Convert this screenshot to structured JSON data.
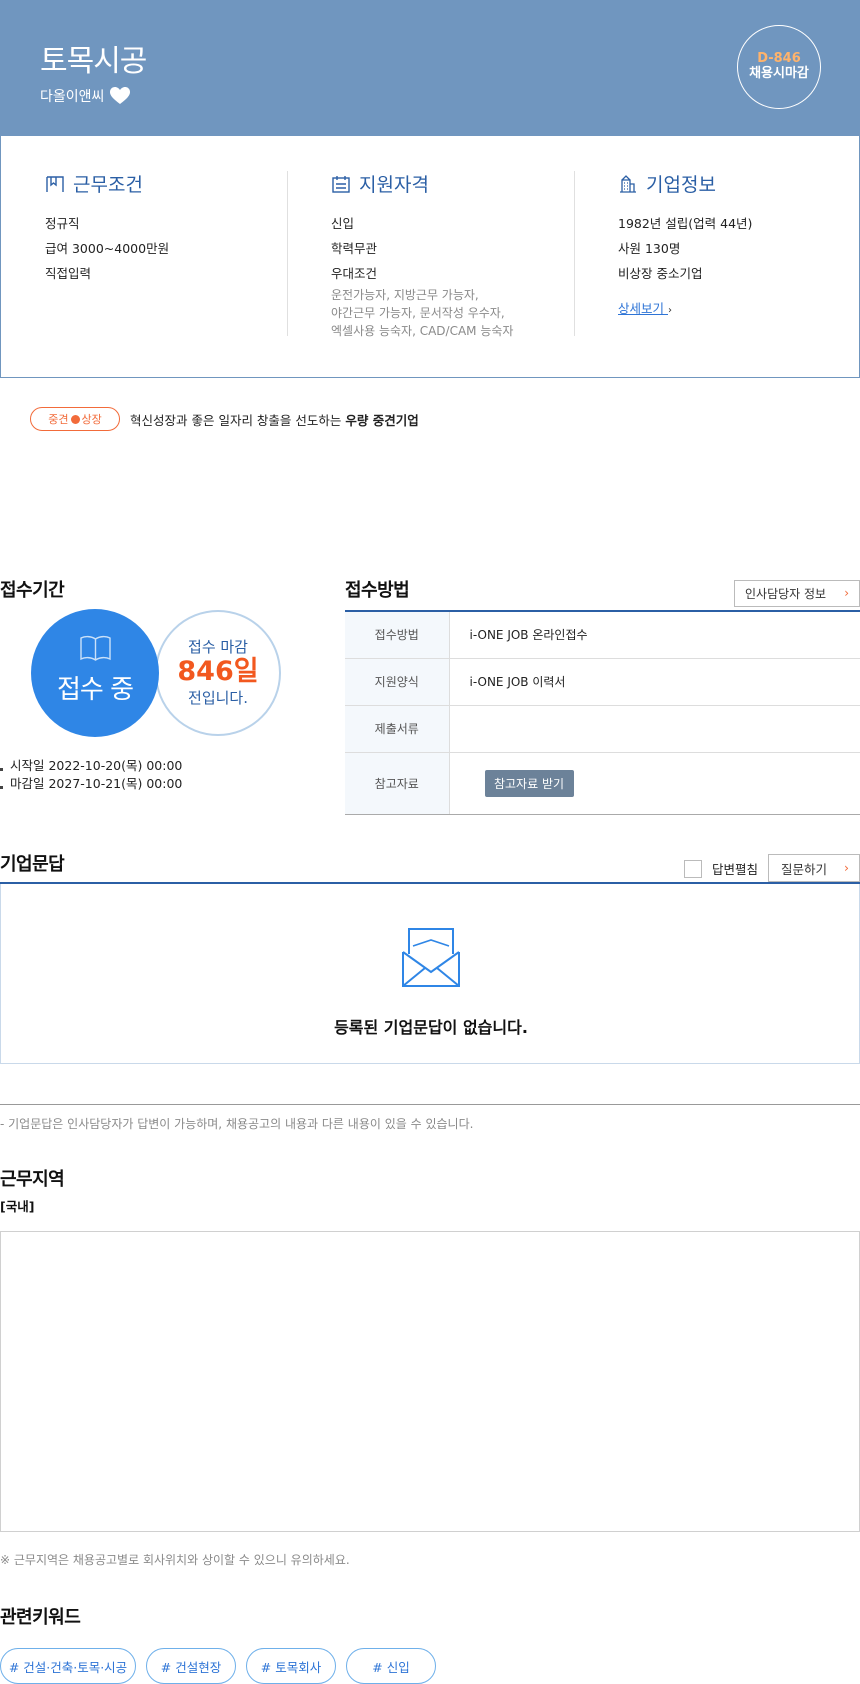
{
  "header": {
    "title": "토목시공",
    "company": "다올이앤씨",
    "dday": "D-846",
    "deadline_label": "채용시마감",
    "colors": {
      "hero_bg": "#7096bf",
      "accent": "#2b5fa5",
      "orange": "#f26b3a"
    }
  },
  "conditions": {
    "title": "근무조건",
    "icon": "bookmark-icon",
    "items": [
      "정규직",
      "급여 3000~4000만원",
      "직접입력"
    ]
  },
  "qualifications": {
    "title": "지원자격",
    "icon": "calendar-icon",
    "items": [
      "신입",
      "학력무관",
      "우대조건"
    ],
    "preferred": [
      "운전가능자, 지방근무 가능자,",
      "야간근무 가능자, 문서작성 우수자,",
      "엑셀사용 능숙자, CAD/CAM 능숙자"
    ]
  },
  "company_info": {
    "title": "기업정보",
    "icon": "building-icon",
    "items": [
      "1982년 설립(업력 44년)",
      "사원 130명",
      "비상장 중소기업"
    ],
    "detail_link": "상세보기"
  },
  "badge": {
    "left": "중견",
    "right": "상장",
    "text_prefix": "혁신성장과 좋은 일자리 창출을 선도하는 ",
    "text_bold": "우량 중견기업"
  },
  "period": {
    "title": "접수기간",
    "status": "접수 중",
    "deadline_top": "접수 마감",
    "days": "846일",
    "deadline_bottom": "전입니다.",
    "start": "시작일 2022-10-20(목) 00:00",
    "end": "마감일 2027-10-21(목) 00:00"
  },
  "method": {
    "title": "접수방법",
    "hr_button": "인사담당자 정보",
    "rows": [
      {
        "key": "접수방법",
        "value": "i-ONE JOB 온라인접수"
      },
      {
        "key": "지원양식",
        "value": "i-ONE JOB 이력서"
      },
      {
        "key": "제출서류",
        "value": ""
      },
      {
        "key": "참고자료",
        "value": ""
      }
    ],
    "ref_button": "참고자료 받기"
  },
  "qa": {
    "title": "기업문답",
    "expand_label": "답변펼침",
    "ask_button": "질문하기",
    "empty_text": "등록된 기업문답이 없습니다.",
    "note": "- 기업문답은 인사담당자가 답변이 가능하며, 채용공고의 내용과 다른 내용이 있을 수 있습니다."
  },
  "location": {
    "title": "근무지역",
    "tag": "[국내]",
    "note": "※ 근무지역은 채용공고별로 회사위치와 상이할 수 있으니 유의하세요."
  },
  "keywords": {
    "title": "관련키워드",
    "items": [
      "# 건설·건축·토목·시공",
      "# 건설현장",
      "# 토목회사",
      "# 신입"
    ]
  }
}
